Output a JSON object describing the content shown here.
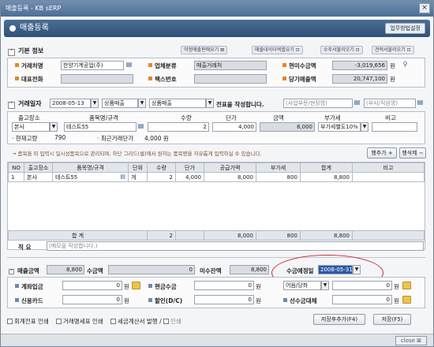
{
  "window": {
    "title": "매출등록 - KB sERP",
    "close": "×"
  },
  "header": {
    "title": "매출등록",
    "help_button": "업무방법설정"
  },
  "toplinks": [
    "약정매출판매요기 ⊠",
    "매출데이터엑셀요기 ⊡",
    "수주서불러오기 ⊡",
    "견적서불러오기 ⊡"
  ],
  "basic": {
    "section_title": "기본 정보",
    "customer_label": "거래처명",
    "customer_value": "한양기계공업(주)",
    "phone_label": "대표전화",
    "phone_value": "",
    "type_label": "업체분류",
    "type_value": "매출거래처",
    "fax_label": "팩스번호",
    "fax_value": "",
    "receivable_label": "현미수금액",
    "receivable_value": "-3,019,656",
    "current_label": "당기매출액",
    "current_value": "20,747,100",
    "unit": "원"
  },
  "trade": {
    "date_label": "거래일자",
    "date_value": "2008-05-13",
    "kind_value": "상품매출",
    "kind2_value": "상품매출",
    "note": "전표을 작성합니다.",
    "branch_placeholder": "(사업부문/현장명)",
    "dept_placeholder": "(부서/직원명)"
  },
  "entry": {
    "headers": [
      "출고장소",
      "품목명/규격",
      "수량",
      "단가",
      "금액",
      "부가세",
      "비고"
    ],
    "place": "본사",
    "item": "테스트55",
    "qty": "2",
    "price": "4,000",
    "amount": "8,000",
    "vat_type": "부가세별도10%",
    "stock_label": "현재고량",
    "stock_value": "790",
    "last_price_label": "최근거래단가",
    "last_price_value": "4,000 원"
  },
  "hint": "→ 품목을 미 입력시 일시성품목으로 관리되며, 하단 그리드(셀)에서 원하는 품목명을 자유롭게 입력하실 수 있습니다.",
  "row_add": "행추가",
  "row_del": "행삭제",
  "grid": {
    "headers": [
      "NO",
      "출고장소",
      "품목명/규격",
      "단위",
      "수량",
      "단가",
      "공급가액",
      "부가세",
      "합계",
      "비고"
    ],
    "rows": [
      [
        "1",
        "본사",
        "테스트55",
        "개",
        "2",
        "4,000",
        "8,000",
        "800",
        "8,800",
        ""
      ]
    ],
    "total_label": "합    계",
    "total_qty": "2",
    "total_supply": "8,000",
    "total_vat": "800",
    "total_sum": "8,800"
  },
  "memo": {
    "label": "적  요",
    "placeholder": "(메모을 작성합니다.)"
  },
  "summary": {
    "sales_label": "매출금액",
    "sales_value": "8,800",
    "collect_label": "수금액",
    "collect_value": "0",
    "uncollect_label": "미수잔액",
    "uncollect_value": "8,800",
    "due_label": "수금예정일",
    "due_value": "2008-05-31"
  },
  "payments": {
    "account_label": "계좌입금",
    "account_value": "0",
    "cash_label": "현금수금",
    "cash_value": "0",
    "bill_select": "어음/당좌",
    "bill_value": "0",
    "card_label": "신용카드",
    "card_value": "0",
    "discount_label": "할인(D/C)",
    "discount_value": "0",
    "prepay_label": "선수금대체",
    "prepay_value": "0",
    "unit": "원"
  },
  "checks": [
    "회계전표 인쇄",
    "거래명세표 인쇄",
    "세금계산서 발행"
  ],
  "checks_extra": "인쇄",
  "buttons": {
    "save_add": "저장후추가(F4)",
    "save": "저장(F5)",
    "close": "close"
  }
}
